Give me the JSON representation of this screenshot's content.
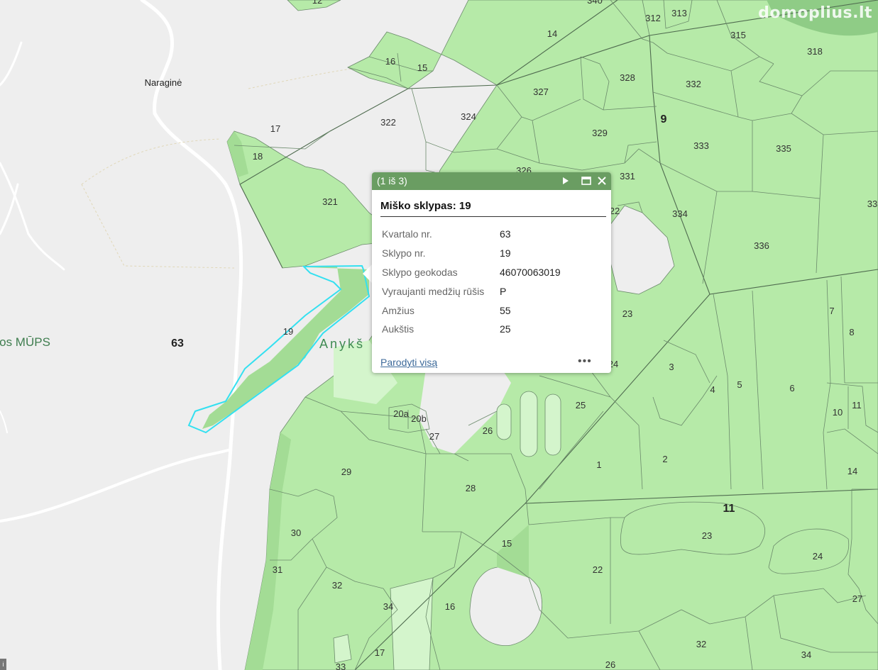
{
  "watermark": "domoplius.lt",
  "map": {
    "colors": {
      "forest": "#b6eaa8",
      "forest_dark": "#a3dc95",
      "forest_light": "#d4f5cc",
      "background": "#eeeeee",
      "boundary": "#6b8a6b",
      "selection": "#33e0f0",
      "popup_header": "#6a9d62"
    },
    "place_names": {
      "village": "Naraginė",
      "mups": "os MŪPS",
      "area": "Anykš"
    },
    "quarter_labels": [
      "63",
      "9",
      "11"
    ],
    "parcel_labels": {
      "p12": "12",
      "p340": "340",
      "p312": "312",
      "p313": "313",
      "p14top": "14",
      "p315": "315",
      "p318": "318",
      "p16": "16",
      "p15top": "15",
      "p327": "327",
      "p328": "328",
      "p332": "332",
      "p17": "17",
      "p322": "322",
      "p324": "324",
      "p329": "329",
      "p333": "333",
      "p335": "335",
      "p18": "18",
      "p326": "326",
      "p331": "331",
      "p321": "321",
      "p22top": "22",
      "p334": "334",
      "p33": "33",
      "p336": "336",
      "p19": "19",
      "p23top": "23",
      "p7": "7",
      "p8": "8",
      "p24": "24",
      "p3": "3",
      "p4": "4",
      "p5": "5",
      "p6": "6",
      "p20a": "20a",
      "p20b": "20b",
      "p27": "27",
      "p26": "26",
      "p25": "25",
      "p10": "10",
      "p11": "11",
      "p29": "29",
      "p28": "28",
      "p1": "1",
      "p2": "2",
      "p14right": "14",
      "p30": "30",
      "p15": "15",
      "p23": "23",
      "p24b": "24",
      "p31": "31",
      "p22": "22",
      "p32": "32",
      "p34": "34",
      "p16b": "16",
      "p27b": "27",
      "p17b": "17",
      "p33b": "33",
      "p26b": "26",
      "p32b": "32",
      "p34b": "34"
    }
  },
  "popup": {
    "count_text": "(1 iš 3)",
    "title": "Miško sklypas: 19",
    "attributes": [
      {
        "key": "Kvartalo nr.",
        "value": "63"
      },
      {
        "key": "Sklypo nr.",
        "value": "19"
      },
      {
        "key": "Sklypo geokodas",
        "value": "46070063019"
      },
      {
        "key": "Vyraujanti medžių rūšis",
        "value": "P"
      },
      {
        "key": "Amžius",
        "value": "55"
      },
      {
        "key": "Aukštis",
        "value": "25"
      }
    ],
    "zoom_link": "Parodyti visą",
    "more_label": "•••",
    "icons": {
      "next": "play-icon",
      "maximize": "maximize-icon",
      "close": "close-icon"
    }
  },
  "corner_attribution": "i"
}
